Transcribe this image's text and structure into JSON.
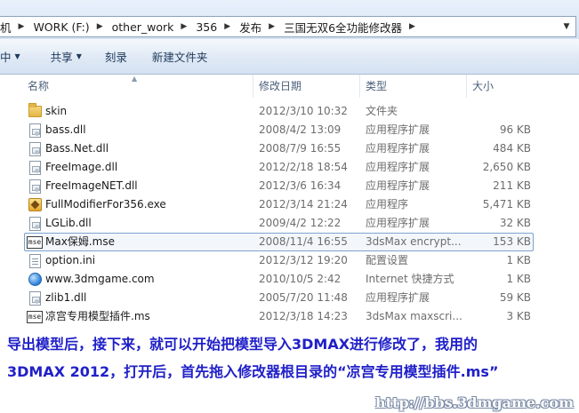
{
  "address_bar": {
    "crumbs": [
      "机",
      "WORK (F:)",
      "other_work",
      "356",
      "发布",
      "三国无双6全功能修改器"
    ]
  },
  "toolbar": {
    "items": [
      {
        "label": "中",
        "has_dropdown": true
      },
      {
        "label": "共享",
        "has_dropdown": true
      },
      {
        "label": "刻录",
        "has_dropdown": false
      },
      {
        "label": "新建文件夹",
        "has_dropdown": false
      }
    ]
  },
  "columns": {
    "name": "名称",
    "date": "修改日期",
    "type": "类型",
    "size": "大小"
  },
  "files": [
    {
      "name": "skin",
      "date": "2012/3/10 10:32",
      "type": "文件夹",
      "size": "",
      "icon": "folder-icon"
    },
    {
      "name": "bass.dll",
      "date": "2008/4/2 13:09",
      "type": "应用程序扩展",
      "size": "96 KB",
      "icon": "dll-file-icon"
    },
    {
      "name": "Bass.Net.dll",
      "date": "2008/7/9 16:55",
      "type": "应用程序扩展",
      "size": "484 KB",
      "icon": "dll-file-icon"
    },
    {
      "name": "FreeImage.dll",
      "date": "2012/2/18 18:54",
      "type": "应用程序扩展",
      "size": "2,650 KB",
      "icon": "dll-file-icon"
    },
    {
      "name": "FreeImageNET.dll",
      "date": "2012/3/6 16:34",
      "type": "应用程序扩展",
      "size": "211 KB",
      "icon": "dll-file-icon"
    },
    {
      "name": "FullModifierFor356.exe",
      "date": "2012/3/14 21:24",
      "type": "应用程序",
      "size": "5,471 KB",
      "icon": "exe-app-icon"
    },
    {
      "name": "LGLib.dll",
      "date": "2009/4/2 12:22",
      "type": "应用程序扩展",
      "size": "32 KB",
      "icon": "dll-file-icon"
    },
    {
      "name": "Max保姆.mse",
      "date": "2008/11/4 16:55",
      "type": "3dsMax encrypt...",
      "size": "153 KB",
      "icon": "mse-file-icon",
      "selected": true
    },
    {
      "name": "option.ini",
      "date": "2012/3/12 19:20",
      "type": "配置设置",
      "size": "1 KB",
      "icon": "ini-file-icon"
    },
    {
      "name": "www.3dmgame.com",
      "date": "2010/10/5 2:42",
      "type": "Internet 快捷方式",
      "size": "1 KB",
      "icon": "internet-shortcut-icon"
    },
    {
      "name": "zlib1.dll",
      "date": "2005/7/20 11:48",
      "type": "应用程序扩展",
      "size": "59 KB",
      "icon": "dll-file-icon"
    },
    {
      "name": "凉宫专用模型插件.ms",
      "date": "2012/3/18 14:23",
      "type": "3dsMax maxscri...",
      "size": "3 KB",
      "icon": "mse-file-icon"
    }
  ],
  "caption": {
    "line1": "导出模型后，接下来，就可以开始把模型导入3DMAX进行修改了，我用的",
    "line2": "3DMAX 2012，打开后，首先拖入修改器根目录的“凉宫专用模型插件.ms”"
  },
  "watermark": "http://bbs.3dmgame.com",
  "colors": {
    "caption_text": "#2020c8",
    "selection_border": "#7da2ce",
    "toolbar_text": "#1e395b"
  }
}
